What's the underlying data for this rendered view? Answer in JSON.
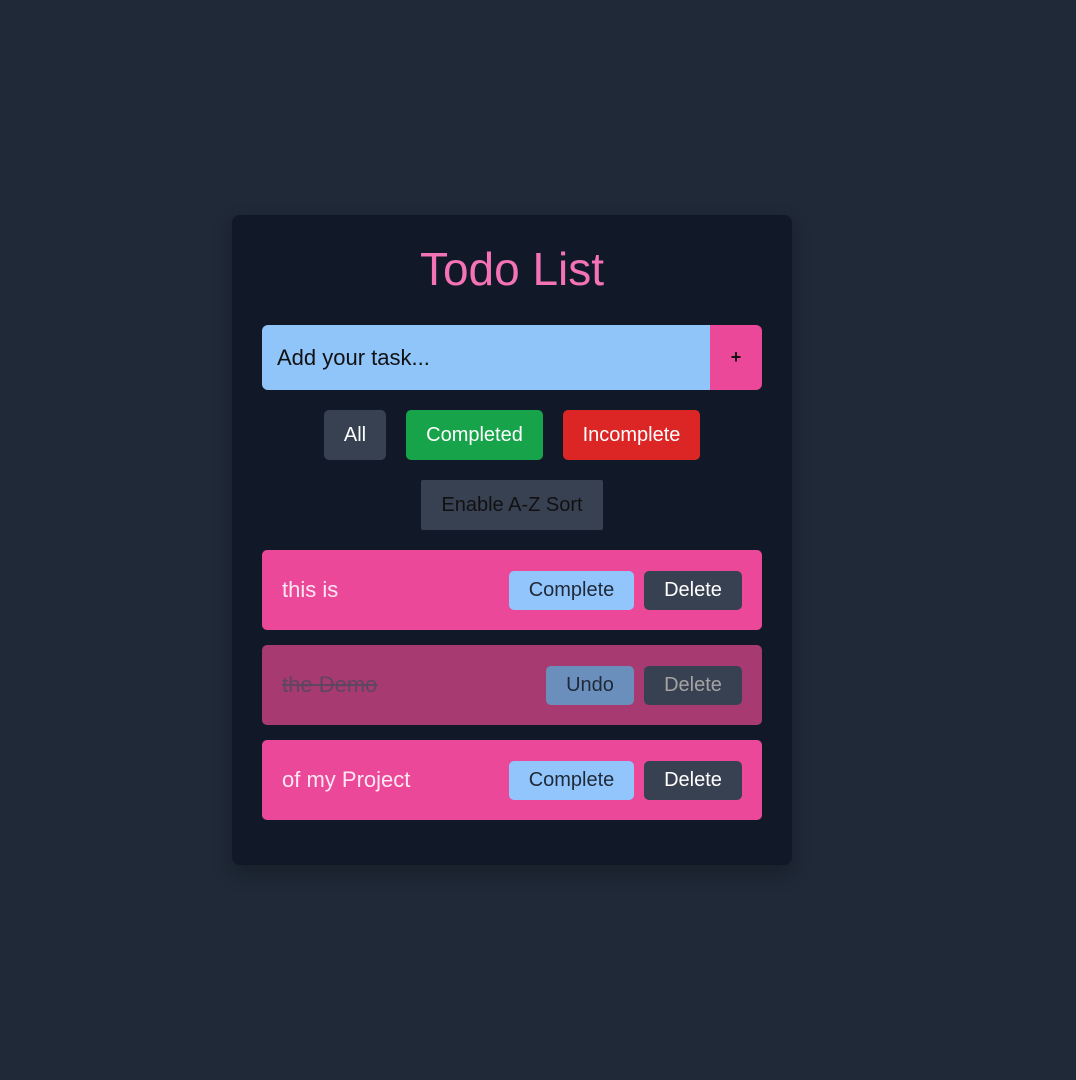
{
  "app": {
    "title": "Todo List"
  },
  "input": {
    "placeholder": "Add your task...",
    "value": "",
    "add_label": "+"
  },
  "filters": {
    "all": "All",
    "completed": "Completed",
    "incomplete": "Incomplete"
  },
  "sort": {
    "label": "Enable A-Z Sort"
  },
  "todos": [
    {
      "text": "this is",
      "completed": false,
      "action_label": "Complete",
      "delete_label": "Delete"
    },
    {
      "text": "the Demo",
      "completed": true,
      "action_label": "Undo",
      "delete_label": "Delete"
    },
    {
      "text": "of my Project",
      "completed": false,
      "action_label": "Complete",
      "delete_label": "Delete"
    }
  ],
  "colors": {
    "background": "#1f2937",
    "card": "#111827",
    "accent_pink": "#ec4899",
    "title_pink": "#f472b6",
    "input_blue": "#90c5fa",
    "completed_green": "#16a34a",
    "incomplete_red": "#dc2626"
  }
}
